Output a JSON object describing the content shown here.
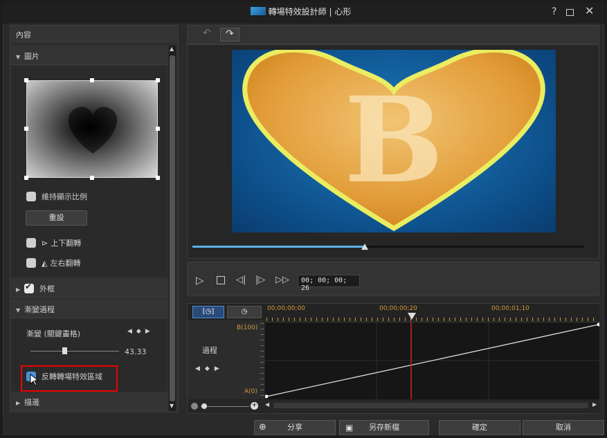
{
  "window": {
    "title": "轉場特效設計師 | 心形"
  },
  "left_panel": {
    "header": "內容",
    "image_section": {
      "label": "圖片",
      "keep_ratio_label": "維持顯示比例",
      "reset_label": "重設",
      "flip_vertical_label": "上下翻轉",
      "flip_horizontal_label": "左右翻轉"
    },
    "frame_section": {
      "label": "外框"
    },
    "gradient_section": {
      "label": "漸變過程",
      "keyframe_label": "漸變 (關鍵畫格)",
      "value": "43.33",
      "invert_label": "反轉轉場特效區域"
    },
    "outline_section": {
      "label": "描邊"
    }
  },
  "preview": {
    "progress": 0.44,
    "timecode": "00; 00; 00; 26"
  },
  "timeline": {
    "ticks": [
      "00;00;00;00",
      "00;00;00;20",
      "00;00;01;10"
    ],
    "top_label": "B(100)",
    "bottom_label": "A(0)",
    "track_label": "過程"
  },
  "footer": {
    "share_label": "分享",
    "save_as_label": "另存新檔",
    "ok_label": "確定",
    "cancel_label": "取消"
  }
}
